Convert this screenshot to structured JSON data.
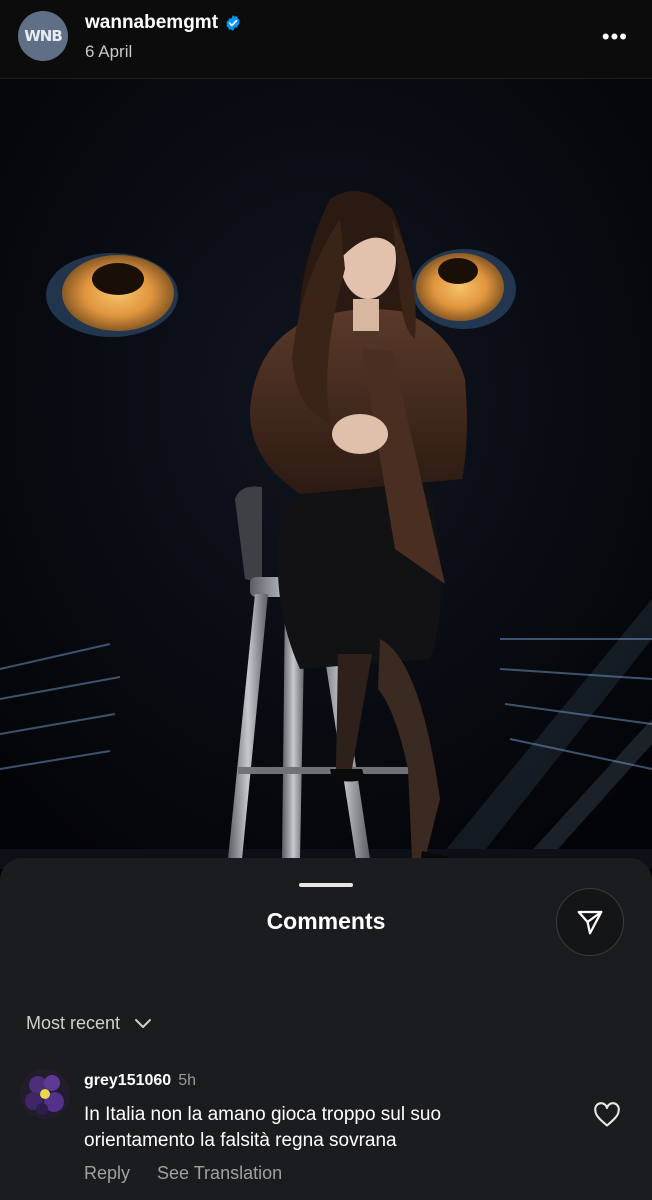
{
  "header": {
    "avatar_text": "WNB",
    "username": "wannabemgmt",
    "date": "6 April",
    "more_icon": "more-horizontal-icon"
  },
  "comments_sheet": {
    "title": "Comments",
    "sort_label": "Most recent",
    "comments": [
      {
        "username": "grey151060",
        "time": "5h",
        "text": "In Italia non la amano gioca troppo sul suo orientamento la falsità regna sovrana",
        "reply_label": "Reply",
        "translate_label": "See Translation"
      }
    ]
  },
  "colors": {
    "verified": "#0095f6",
    "sheet_bg": "#1b1c1f",
    "eye": "#e3a04a"
  }
}
